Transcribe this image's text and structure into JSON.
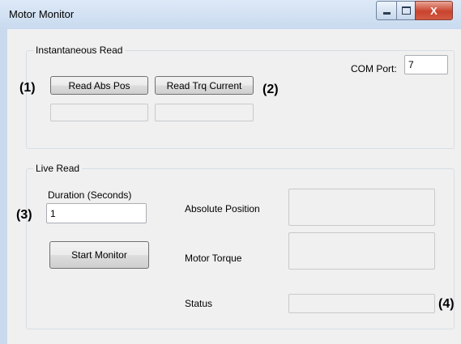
{
  "window": {
    "title": "Motor Monitor",
    "close_glyph": "X",
    "icons": [
      "minimize-icon",
      "maximize-icon",
      "close-icon"
    ]
  },
  "instantaneous": {
    "legend": "Instantaneous Read",
    "com_port_label": "COM Port:",
    "com_port_value": "7",
    "read_abs_pos_label": "Read Abs Pos",
    "read_trq_current_label": "Read Trq Current",
    "abs_pos_output": "",
    "trq_current_output": ""
  },
  "live": {
    "legend": "Live Read",
    "duration_label": "Duration (Seconds)",
    "duration_value": "1",
    "start_monitor_label": "Start Monitor",
    "absolute_position_label": "Absolute Position",
    "motor_torque_label": "Motor Torque",
    "status_label": "Status",
    "absolute_position_value": "",
    "motor_torque_value": "",
    "status_value": ""
  },
  "annotations": {
    "m1": "(1)",
    "m2": "(2)",
    "m3": "(3)",
    "m4": "(4)"
  }
}
